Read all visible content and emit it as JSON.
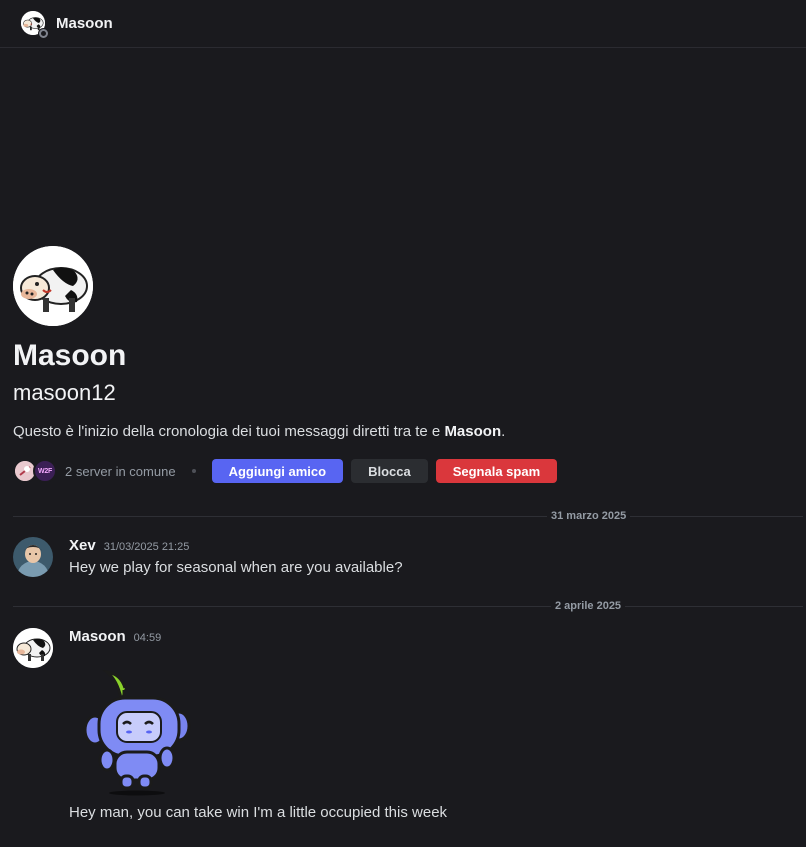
{
  "header": {
    "name": "Masoon",
    "avatar_icon": "cow-avatar-icon",
    "status": "offline"
  },
  "intro": {
    "display_name": "Masoon",
    "username": "masoon12",
    "text_prefix": "Questo è l'inizio della cronologia dei tuoi messaggi diretti tra te e ",
    "text_name": "Masoon",
    "text_suffix": ".",
    "server_icon_2_label": "W2F",
    "servers_in_common": "2 server in comune",
    "buttons": {
      "add_friend": "Aggiungi amico",
      "block": "Blocca",
      "report_spam": "Segnala spam"
    }
  },
  "dividers": [
    {
      "label": "31 marzo 2025"
    },
    {
      "label": "2 aprile 2025"
    }
  ],
  "messages": [
    {
      "author": "Xev",
      "timestamp": "31/03/2025 21:25",
      "text": "Hey we play for seasonal when are you available?",
      "avatar_icon": "xev-avatar-icon"
    },
    {
      "author": "Masoon",
      "timestamp": "04:59",
      "sticker_icon": "wumpus-sticker-icon",
      "text": "Hey man, you can take win I'm a little occupied this week",
      "avatar_icon": "cow-avatar-icon"
    }
  ],
  "colors": {
    "background": "#1a1a1e",
    "blurple": "#5865f2",
    "danger": "#da373c",
    "secondary": "#2b2d31"
  }
}
